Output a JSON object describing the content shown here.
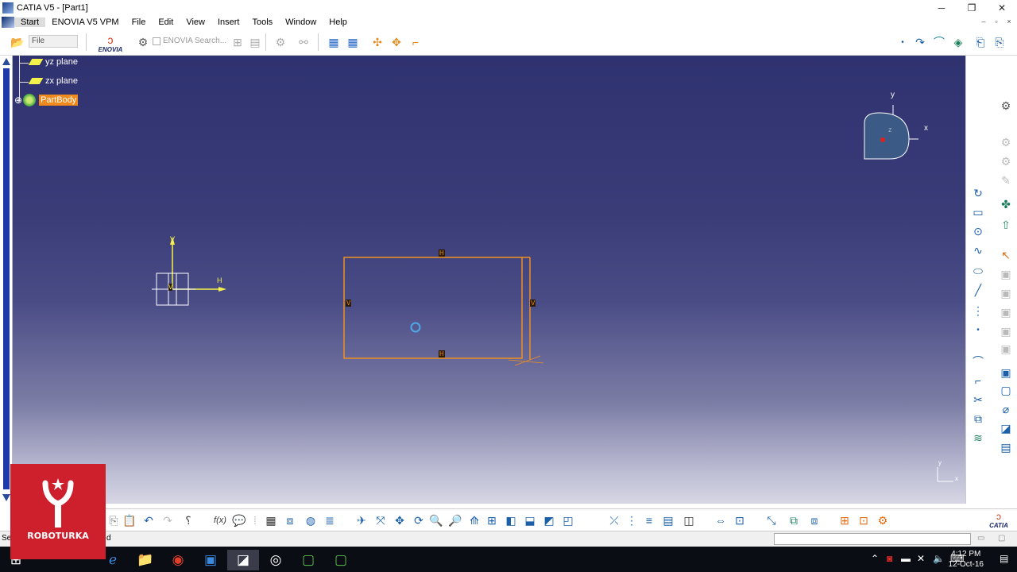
{
  "window": {
    "title": "CATIA V5 - [Part1]",
    "controls": [
      "─",
      "❐",
      "✕"
    ]
  },
  "menubar": {
    "items": [
      {
        "label": "Start",
        "active": true
      },
      {
        "label": "ENOVIA V5 VPM"
      },
      {
        "label": "File"
      },
      {
        "label": "Edit"
      },
      {
        "label": "View"
      },
      {
        "label": "Insert"
      },
      {
        "label": "Tools"
      },
      {
        "label": "Window"
      },
      {
        "label": "Help"
      }
    ],
    "doc_controls": [
      "–",
      "▫",
      "×"
    ]
  },
  "toolbar": {
    "file_combo": "File",
    "enovia_search_placeholder": "ENOVIA Search...",
    "enovia_logo": "ENOVIA"
  },
  "tree": {
    "items": [
      {
        "label": "yz plane",
        "icon": "plane-icon"
      },
      {
        "label": "zx plane",
        "icon": "plane-icon"
      },
      {
        "label": "PartBody",
        "icon": "gear-icon",
        "selected": true
      }
    ]
  },
  "sketch": {
    "h_label": "H",
    "v_label": "V",
    "axis_h": "H",
    "axis_v": "V"
  },
  "compass": {
    "x": "x",
    "y": "y",
    "z": "z"
  },
  "status": {
    "text_left": "Se",
    "text_right": "d"
  },
  "logo": {
    "text": "ROBOTURKA"
  },
  "catia_brand": "CATIA",
  "taskbar": {
    "time": "4:12 PM",
    "date": "12-Oct-16"
  }
}
